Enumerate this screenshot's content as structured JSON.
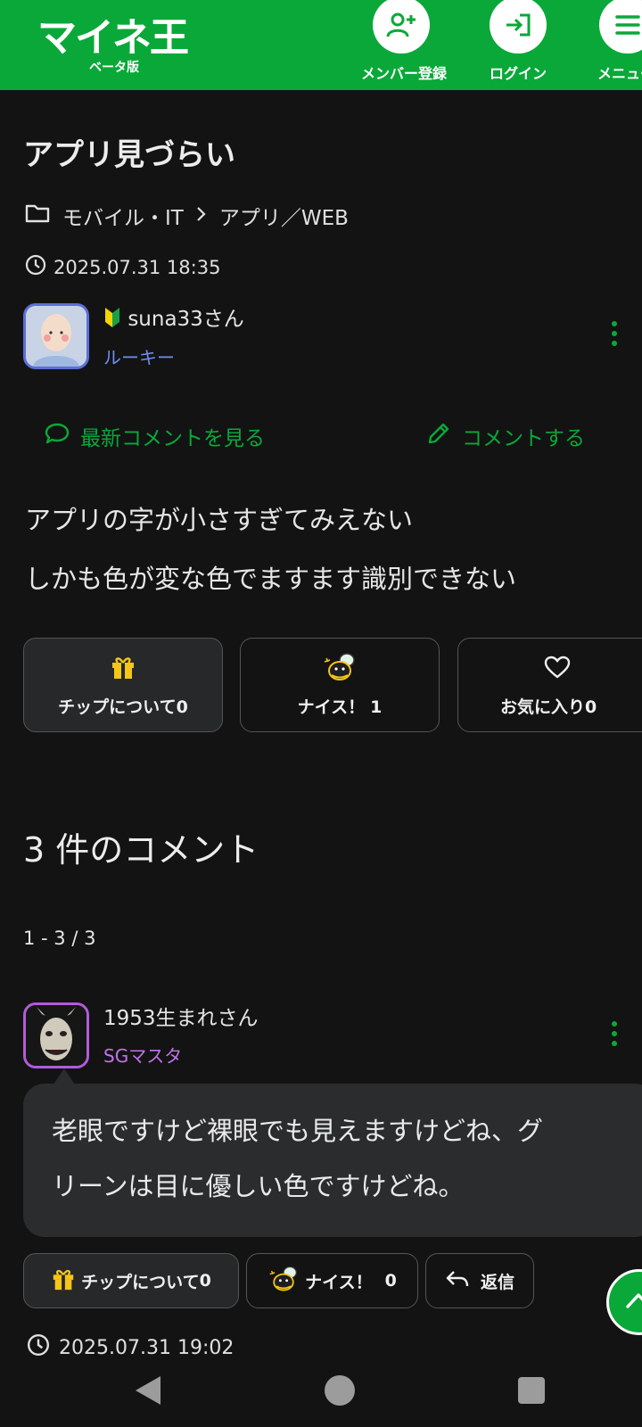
{
  "header": {
    "logo": "マイネ王",
    "logo_sub": "ベータ版",
    "member_label": "メンバー登録",
    "login_label": "ログイン",
    "menu_label": "メニュー"
  },
  "post": {
    "title": "アプリ見づらい",
    "category": "モバイル・IT",
    "subcategory": "アプリ／WEB",
    "datetime": "2025.07.31 18:35",
    "author": "suna33さん",
    "rank": "ルーキー",
    "latest_comment_label": "最新コメントを見る",
    "comment_label": "コメントする",
    "body_line1": "アプリの字が小さすぎてみえない",
    "body_line2": "しかも色が変な色でますます識別できない",
    "tip_label": "チップについて",
    "tip_count": "0",
    "nice_label": "ナイス！",
    "nice_count": "1",
    "fav_label": "お気に入り",
    "fav_count": "0"
  },
  "comments": {
    "count_heading": "3 件のコメント",
    "pager": "1 - 3 / 3",
    "items": [
      {
        "author": "1953生まれさん",
        "rank": "SGマスタ",
        "text_line1": "老眼ですけど裸眼でも見えますけどね、グ",
        "text_line2": "リーンは目に優しい色ですけどね。",
        "tip_label": "チップについて",
        "tip_count": "0",
        "nice_label": "ナイス！",
        "nice_count": "0",
        "reply_label": "返信",
        "datetime": "2025.07.31 19:02"
      }
    ]
  },
  "colors": {
    "accent": "#0aa839",
    "background": "#131313",
    "rank_rookie": "#6f8ef2",
    "rank_master": "#c074e8"
  },
  "icons": [
    "folder-icon",
    "chevron-right-icon",
    "clock-icon",
    "beginner-mark-icon",
    "chat-icon",
    "pencil-icon",
    "gift-icon",
    "nice-bee-icon",
    "heart-icon",
    "reply-icon",
    "chevron-up-icon",
    "user-plus-icon",
    "login-icon",
    "menu-icon"
  ]
}
